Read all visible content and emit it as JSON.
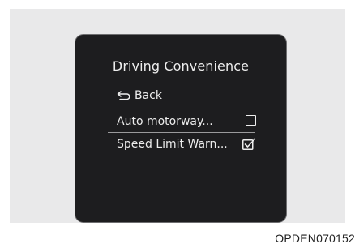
{
  "screen": {
    "title": "Driving Convenience",
    "back_label": "Back",
    "items": [
      {
        "label": "Auto motorway...",
        "checked": false
      },
      {
        "label": "Speed Limit Warn...",
        "checked": true
      }
    ]
  },
  "figure_code": "OPDEN070152"
}
